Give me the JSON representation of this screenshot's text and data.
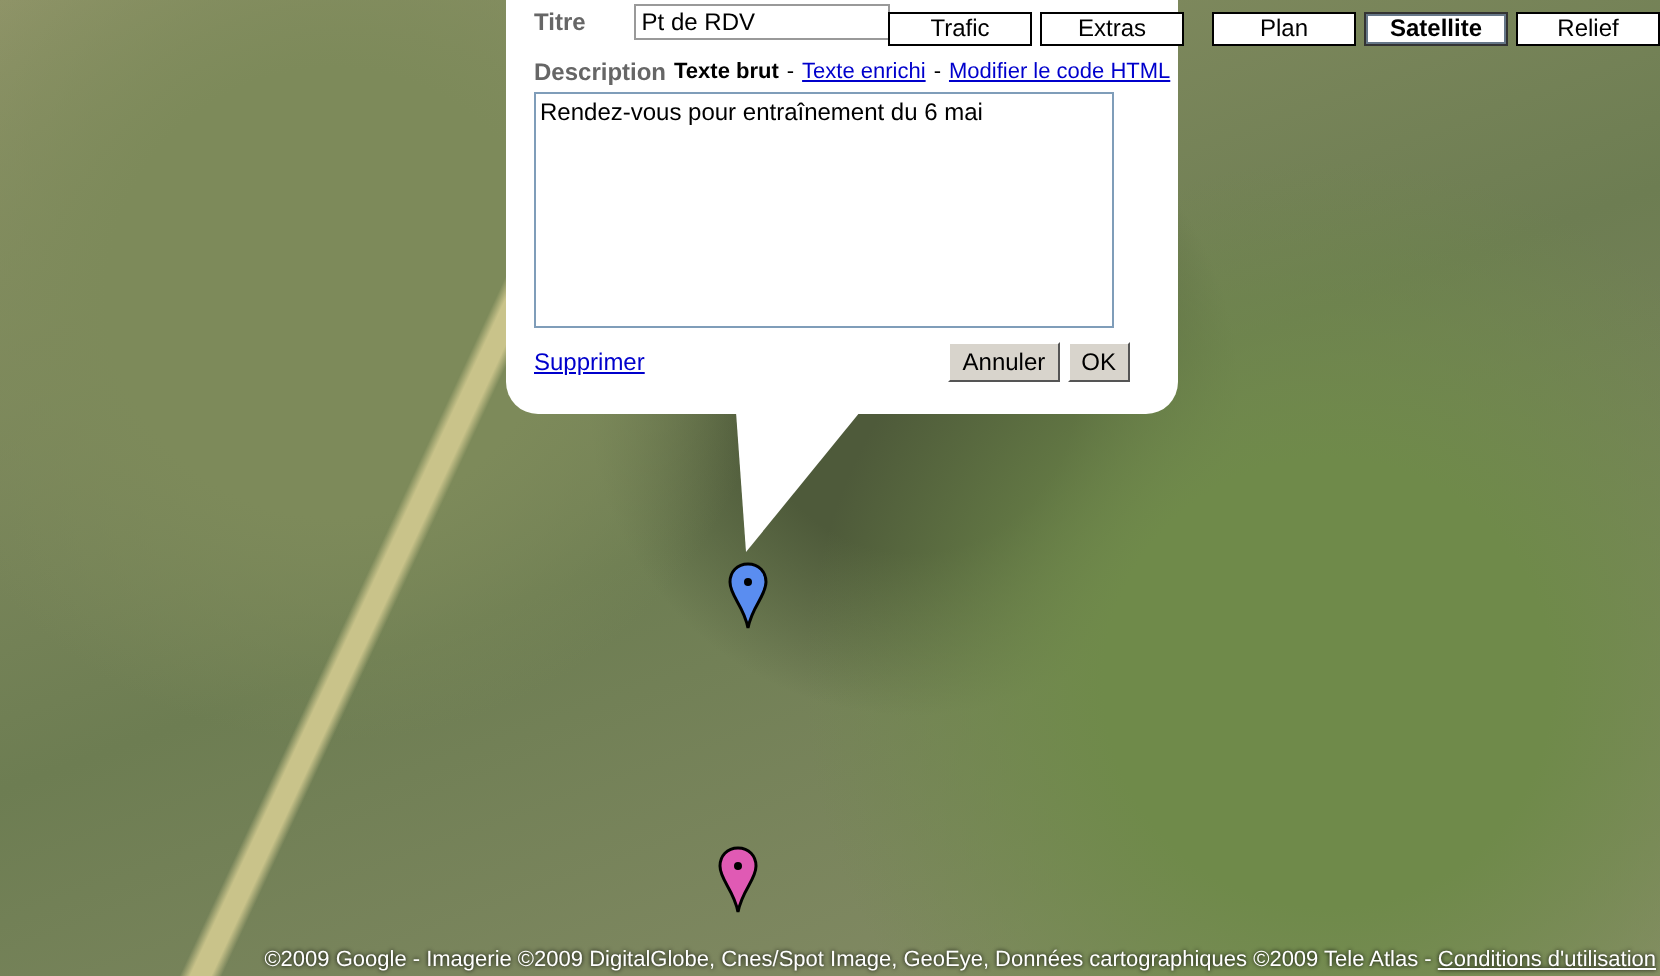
{
  "map_type_buttons": [
    {
      "label": "Plan",
      "selected": false
    },
    {
      "label": "Satellite",
      "selected": true
    },
    {
      "label": "Relief",
      "selected": false
    }
  ],
  "overlay_buttons": [
    {
      "label": "Trafic"
    },
    {
      "label": "Extras"
    }
  ],
  "info_window": {
    "title_label": "Titre",
    "title_value": "Pt de RDV",
    "description_label": "Description",
    "separator": "-",
    "modes": [
      {
        "label": "Texte brut",
        "selected": true
      },
      {
        "label": "Texte enrichi",
        "selected": false
      },
      {
        "label": "Modifier le code HTML",
        "selected": false
      }
    ],
    "description_value": "Rendez-vous pour entraînement du 6 mai",
    "delete_link": "Supprimer",
    "cancel_button": "Annuler",
    "ok_button": "OK"
  },
  "markers": [
    {
      "color": "#5a8df0"
    },
    {
      "color": "#e05ab4"
    }
  ],
  "footer": {
    "copyright": "©2009 Google - Imagerie ©2009 DigitalGlobe, Cnes/Spot Image, GeoEye, Données cartographiques ©2009 Tele Atlas - ",
    "terms_link": "Conditions d'utilisation"
  }
}
